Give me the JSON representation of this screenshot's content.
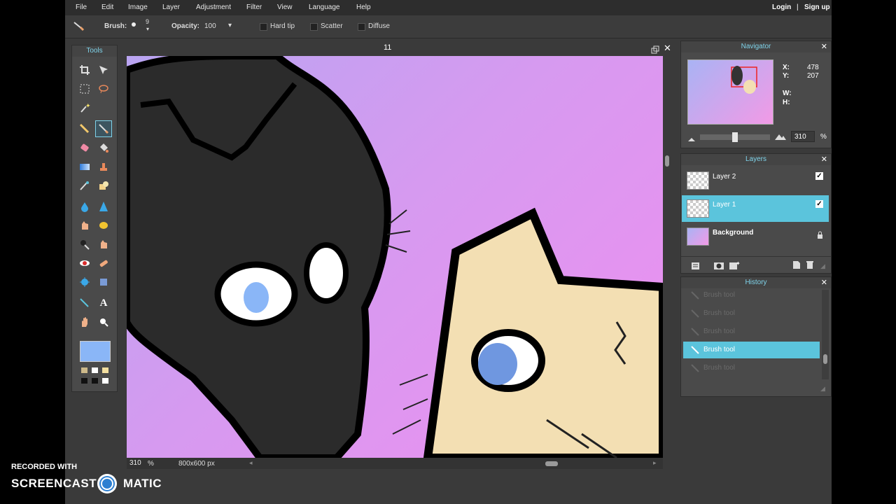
{
  "menu": {
    "items": [
      "File",
      "Edit",
      "Image",
      "Layer",
      "Adjustment",
      "Filter",
      "View",
      "Language",
      "Help"
    ],
    "login": "Login",
    "separator": "|",
    "signup": "Sign up"
  },
  "toolbar": {
    "brush_label": "Brush:",
    "brush_size": "9",
    "opacity_label": "Opacity:",
    "opacity_value": "100",
    "hard_tip": "Hard tip",
    "scatter": "Scatter",
    "diffuse": "Diffuse"
  },
  "tools_panel": {
    "title": "Tools",
    "foreground_color": "#8ab6f7",
    "swatches": [
      "#cdb98a",
      "#ffffff",
      "#f3dfa0",
      "#111111",
      "#111111",
      "#ffffff"
    ]
  },
  "document": {
    "title": "11",
    "zoom": "310",
    "zoom_unit": "%",
    "size": "800x600 px"
  },
  "navigator": {
    "title": "Navigator",
    "x_label": "X:",
    "x_value": "478",
    "y_label": "Y:",
    "y_value": "207",
    "w_label": "W:",
    "h_label": "H:",
    "zoom_value": "310",
    "zoom_unit": "%"
  },
  "layers": {
    "title": "Layers",
    "items": [
      {
        "name": "Layer 2",
        "visible": true,
        "selected": false
      },
      {
        "name": "Layer 1",
        "visible": true,
        "selected": true
      },
      {
        "name": "Background",
        "locked": true,
        "selected": false
      }
    ]
  },
  "history": {
    "title": "History",
    "items": [
      "Brush tool",
      "Brush tool",
      "Brush tool",
      "Brush tool",
      "Brush tool"
    ],
    "active_index": 3
  },
  "watermark": {
    "recorded_with": "RECORDED WITH",
    "brand_left": "SCREENCAST",
    "brand_right": "MATIC"
  },
  "colors": {
    "accent": "#5bc4dc",
    "canvas_dark_cat": "#2b2b2b",
    "canvas_light_cat": "#f3dfb3",
    "eye_blue": "#6f97e0"
  }
}
